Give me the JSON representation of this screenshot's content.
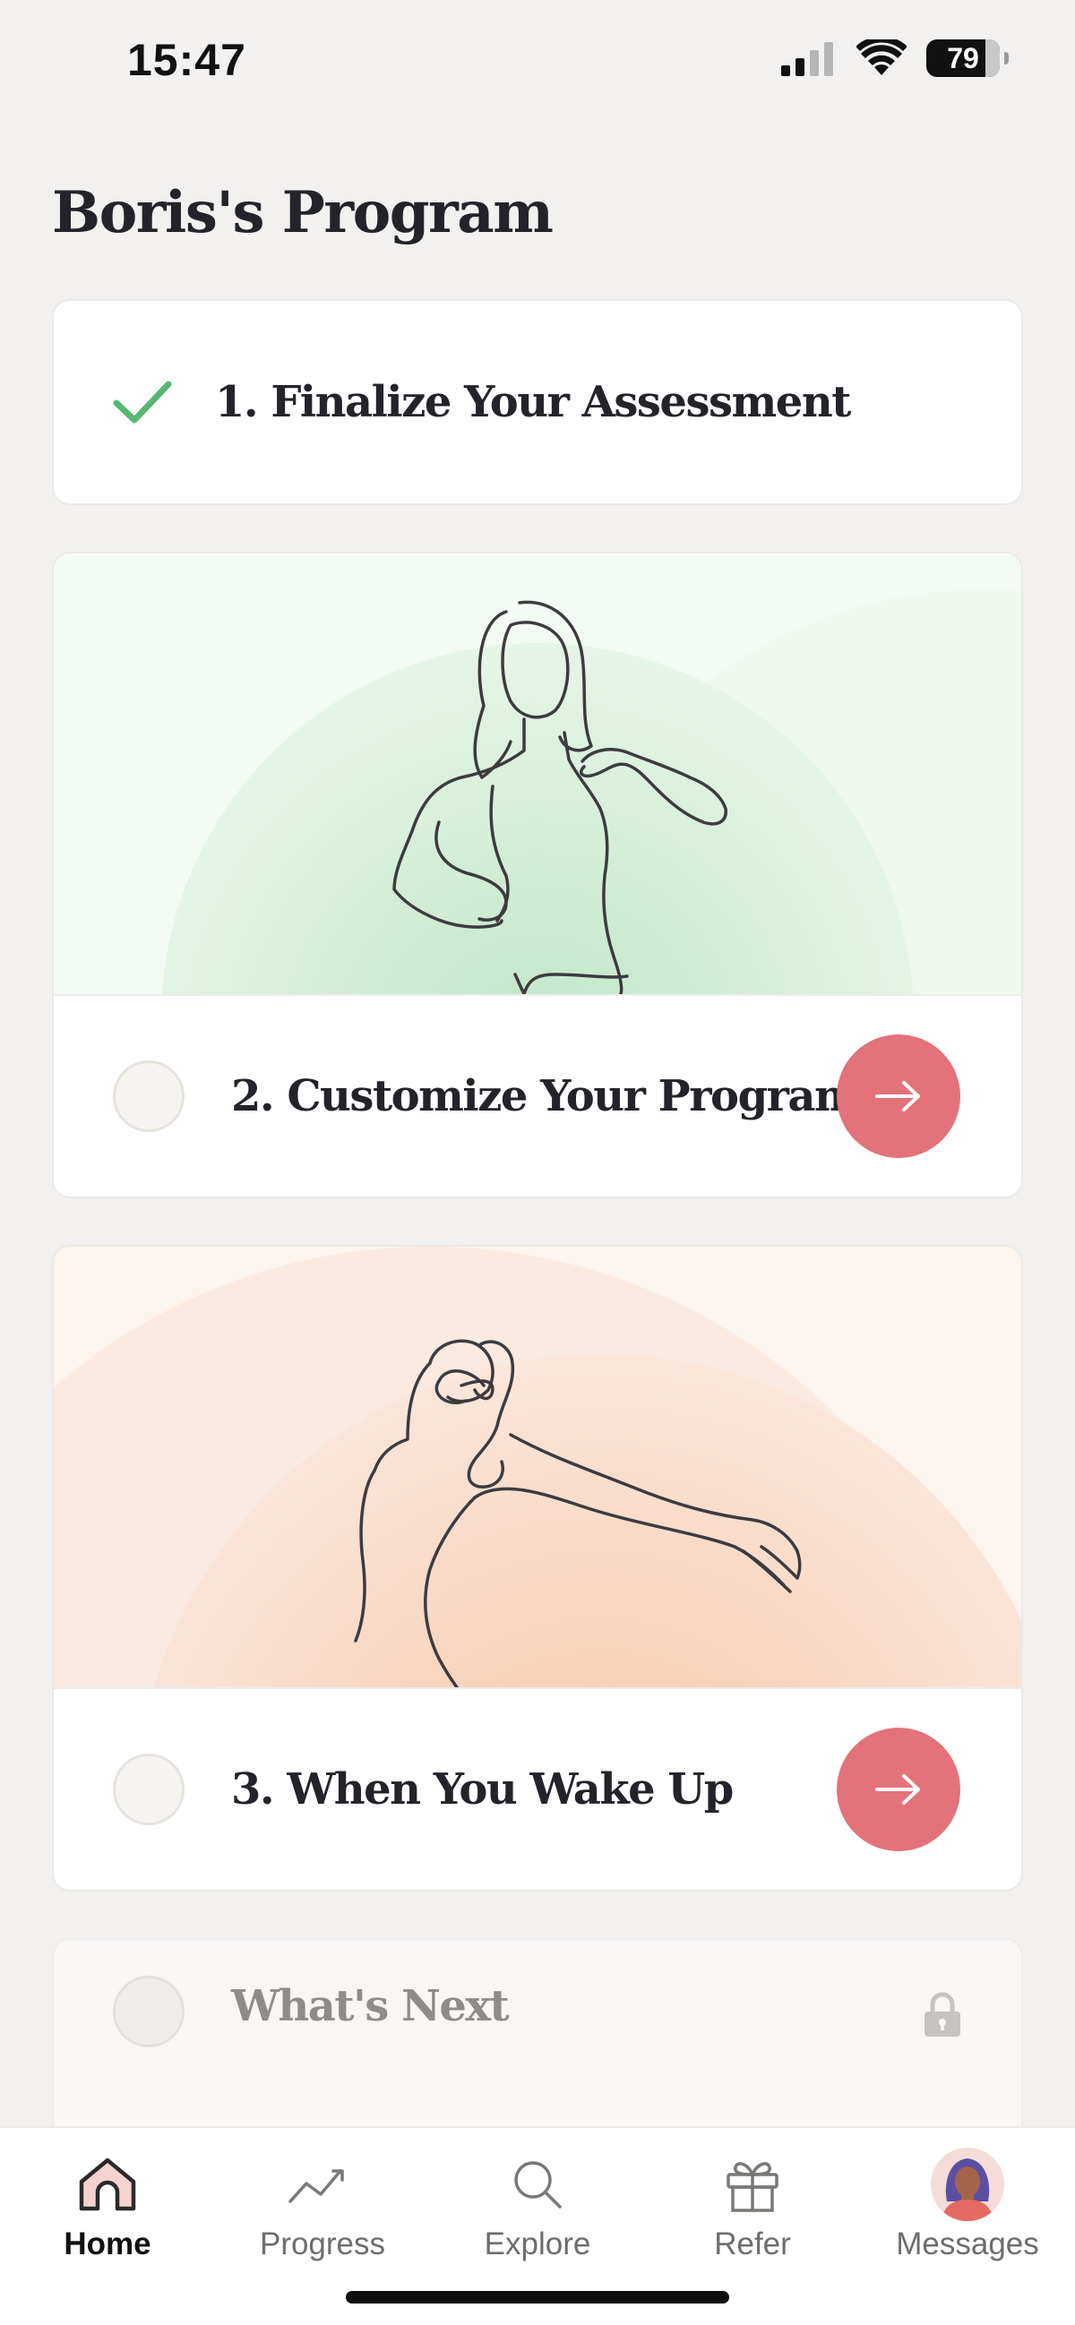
{
  "status_bar": {
    "time": "15:47",
    "battery": "79"
  },
  "page": {
    "title": "Boris's Program"
  },
  "steps": [
    {
      "label": "1. Finalize Your Assessment",
      "state": "completed"
    },
    {
      "label": "2. Customize Your Program",
      "state": "pending",
      "illustration": "woman-pointing-to-self"
    },
    {
      "label": "3. When You Wake Up",
      "state": "pending",
      "illustration": "woman-stretching-arm"
    },
    {
      "label": "What's Next",
      "state": "locked"
    }
  ],
  "tab_bar": {
    "items": [
      {
        "label": "Home",
        "icon": "home-icon",
        "active": true
      },
      {
        "label": "Progress",
        "icon": "trend-icon",
        "active": false
      },
      {
        "label": "Explore",
        "icon": "search-icon",
        "active": false
      },
      {
        "label": "Refer",
        "icon": "gift-icon",
        "active": false
      },
      {
        "label": "Messages",
        "icon": "avatar",
        "active": false
      }
    ]
  },
  "colors": {
    "accent": "#e3727a",
    "check": "#56b870",
    "background": "#f2f1ef"
  }
}
